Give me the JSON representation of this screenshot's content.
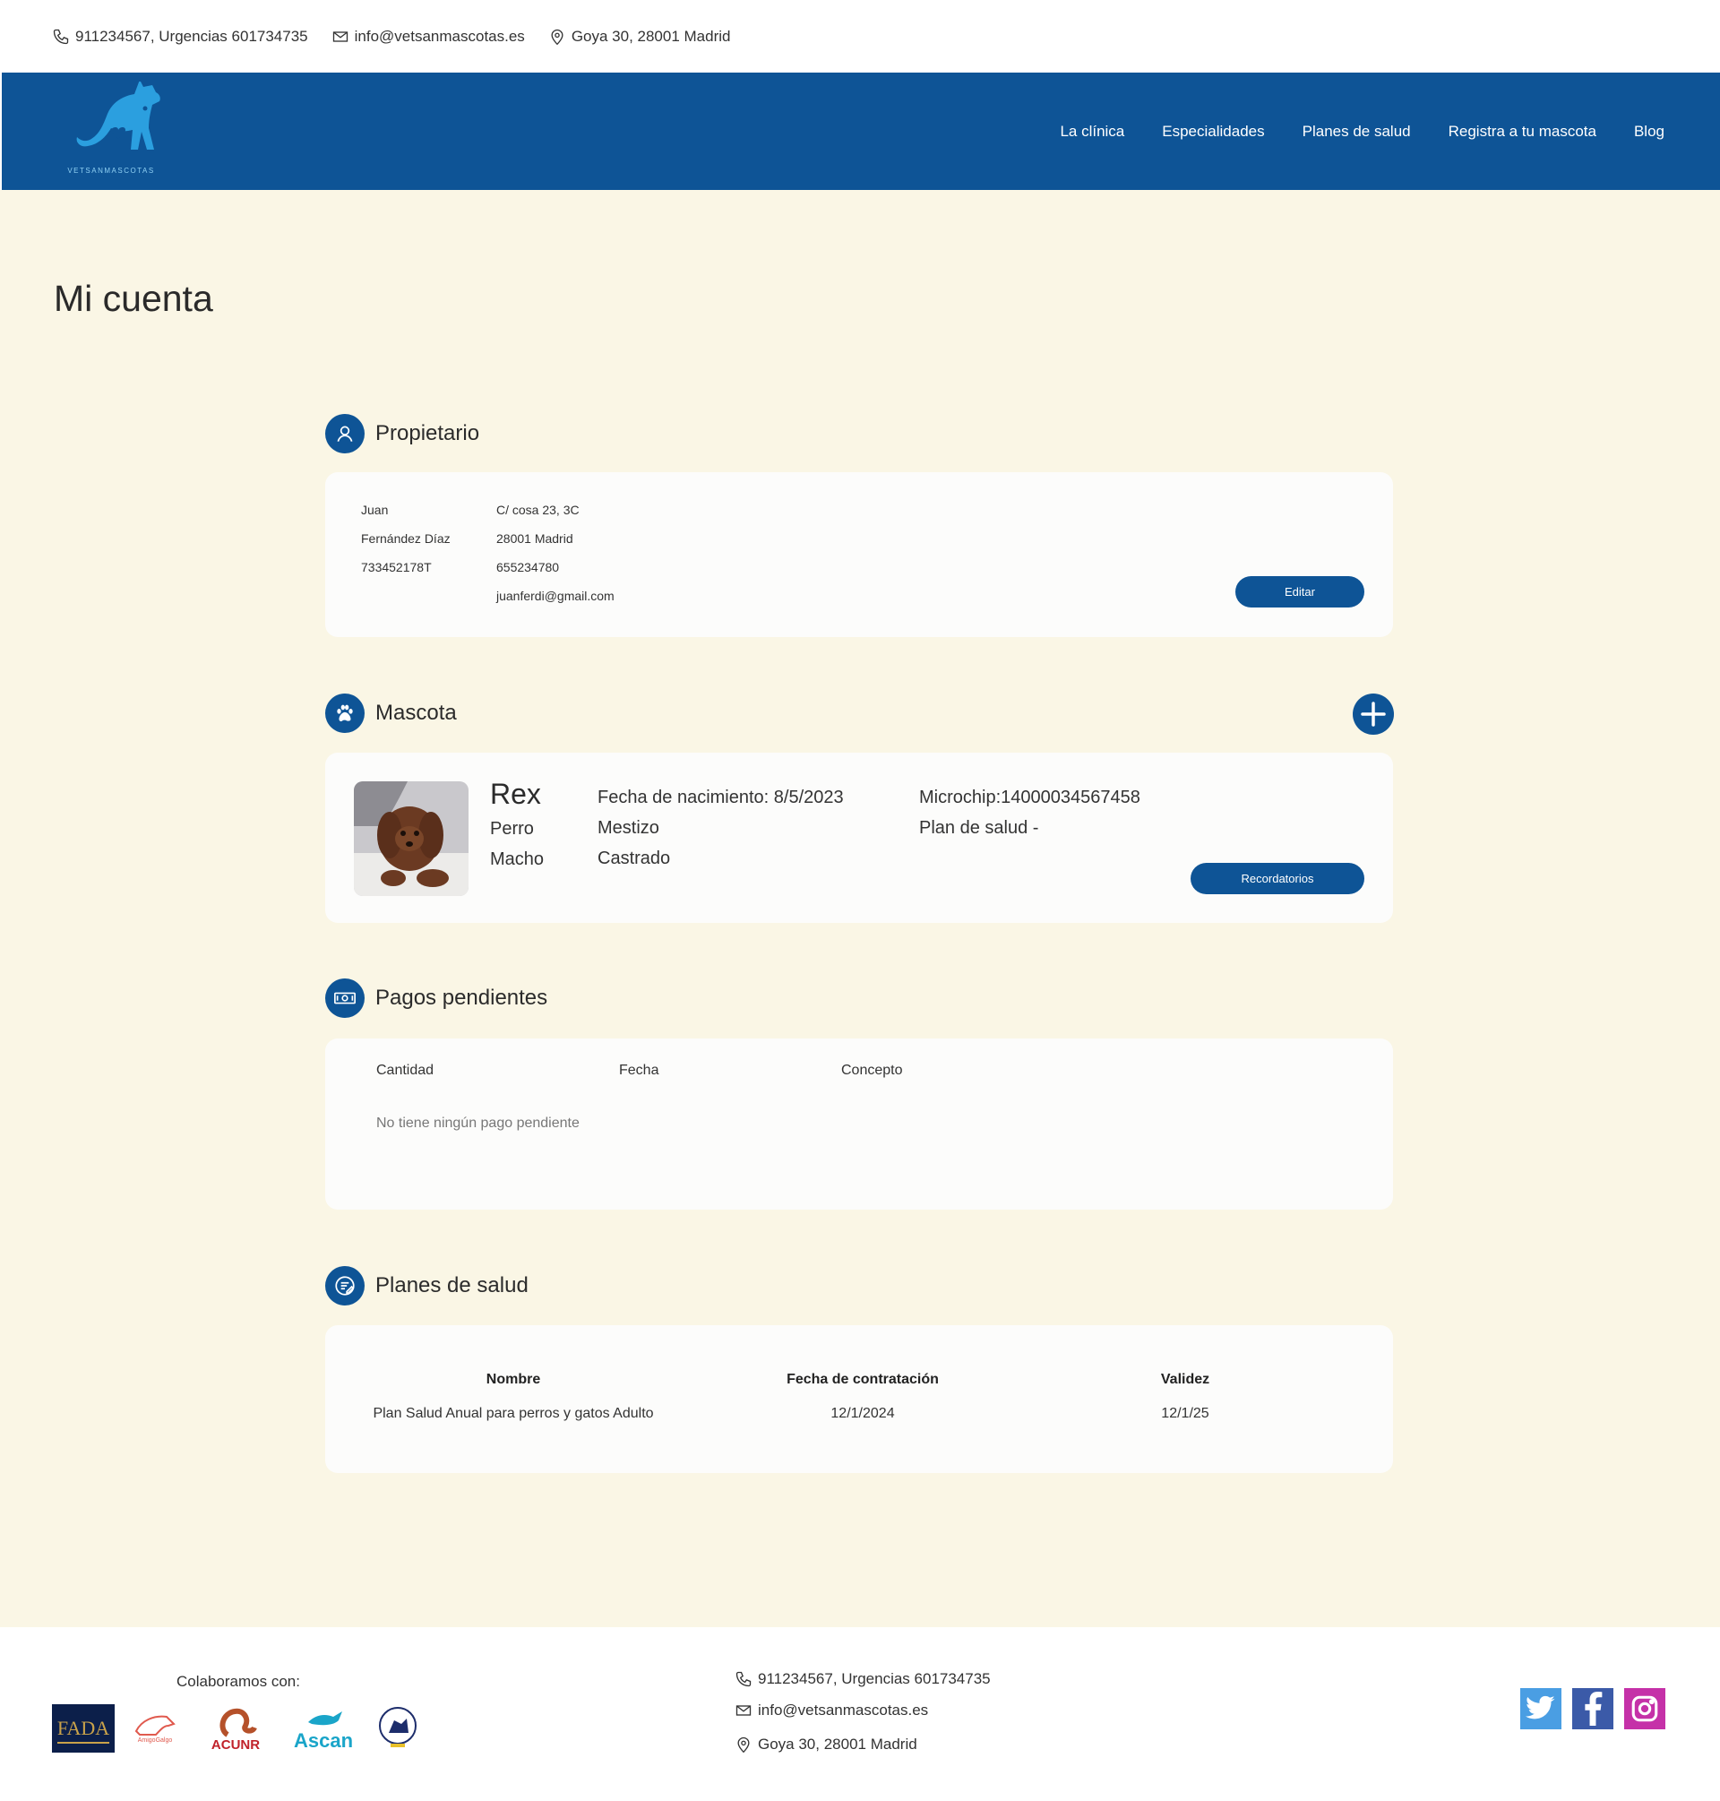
{
  "contact": {
    "phone": "911234567, Urgencias 601734735",
    "email": "info@vetsanmascotas.es",
    "address": "Goya 30, 28001 Madrid"
  },
  "logo": {
    "text": "VETSANMASCOTAS"
  },
  "nav": {
    "items": [
      "La clínica",
      "Especialidades",
      "Planes de salud",
      "Registra a tu mascota",
      "Blog"
    ]
  },
  "page": {
    "title": "Mi cuenta"
  },
  "owner": {
    "section_title": "Propietario",
    "first_name": "Juan",
    "last_name": "Fernández Díaz",
    "dni": "733452178T",
    "street": "C/ cosa 23, 3C",
    "city": "28001 Madrid",
    "phone": "655234780",
    "email": "juanferdi@gmail.com",
    "edit_label": "Editar"
  },
  "pet": {
    "section_title": "Mascota",
    "name": "Rex",
    "species": "Perro",
    "sex": "Macho",
    "birth": "Fecha de nacimiento: 8/5/2023",
    "breed": "Mestizo",
    "neutered": "Castrado",
    "microchip": "Microchip:14000034567458",
    "plan": "Plan de salud -",
    "reminders_label": "Recordatorios"
  },
  "payments": {
    "section_title": "Pagos pendientes",
    "columns": [
      "Cantidad",
      "Fecha",
      "Concepto"
    ],
    "empty_message": "No tiene ningún pago pendiente"
  },
  "plans": {
    "section_title": "Planes de salud",
    "columns": [
      "Nombre",
      "Fecha de contratación",
      "Validez"
    ],
    "rows": [
      {
        "name": "Plan Salud Anual para perros y gatos Adulto",
        "date": "12/1/2024",
        "validity": "12/1/25"
      }
    ]
  },
  "footer": {
    "collab_label": "Colaboramos con:",
    "partners": [
      "FADA",
      "AmigoGalgo",
      "ACUNR",
      "Ascan",
      "partner-5"
    ],
    "socials": [
      "twitter-icon",
      "facebook-icon",
      "instagram-icon"
    ]
  },
  "colors": {
    "brand": "#0e5496",
    "background": "#faf6e5",
    "card": "#fcfcfb",
    "logo": "#2b9fdf"
  }
}
